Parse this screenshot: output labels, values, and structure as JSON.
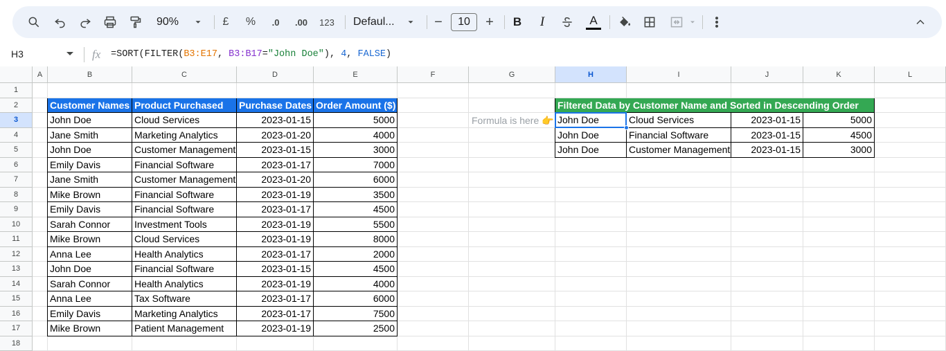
{
  "toolbar": {
    "zoom": "90%",
    "currency": "£",
    "percent": "%",
    "dec_less": ".0",
    "dec_more": ".00",
    "more_formats": "123",
    "font": "Defaul...",
    "font_size": "10",
    "minus": "−",
    "plus": "+",
    "bold": "B",
    "italic": "I",
    "text_color_letter": "A"
  },
  "formula_bar": {
    "name_box": "H3",
    "fx": "fx",
    "formula_parts": [
      "=SORT(FILTER(",
      "B3:E17",
      ", ",
      "B3:B17",
      "=",
      "\"John Doe\"",
      "), ",
      "4",
      ", ",
      "FALSE",
      ")"
    ]
  },
  "columns": [
    "A",
    "B",
    "C",
    "D",
    "E",
    "F",
    "G",
    "H",
    "I",
    "J",
    "K",
    "L"
  ],
  "rows": [
    "1",
    "2",
    "3",
    "4",
    "5",
    "6",
    "7",
    "8",
    "9",
    "10",
    "11",
    "12",
    "13",
    "14",
    "15",
    "16",
    "17",
    "18"
  ],
  "selected_cell": {
    "column": "H",
    "row": "3"
  },
  "source_table": {
    "headers": [
      "Customer Names",
      "Product Purchased",
      "Purchase Dates",
      "Order Amount ($)"
    ],
    "rows": [
      [
        "John Doe",
        "Cloud Services",
        "2023-01-15",
        "5000"
      ],
      [
        "Jane Smith",
        "Marketing Analytics",
        "2023-01-20",
        "4000"
      ],
      [
        "John Doe",
        "Customer Management",
        "2023-01-15",
        "3000"
      ],
      [
        "Emily Davis",
        "Financial Software",
        "2023-01-17",
        "7000"
      ],
      [
        "Jane Smith",
        "Customer Management",
        "2023-01-20",
        "6000"
      ],
      [
        "Mike Brown",
        "Financial Software",
        "2023-01-19",
        "3500"
      ],
      [
        "Emily Davis",
        "Financial Software",
        "2023-01-17",
        "4500"
      ],
      [
        "Sarah Connor",
        "Investment Tools",
        "2023-01-19",
        "5500"
      ],
      [
        "Mike Brown",
        "Cloud Services",
        "2023-01-19",
        "8000"
      ],
      [
        "Anna Lee",
        "Health Analytics",
        "2023-01-17",
        "2000"
      ],
      [
        "John Doe",
        "Financial Software",
        "2023-01-15",
        "4500"
      ],
      [
        "Sarah Connor",
        "Health Analytics",
        "2023-01-19",
        "4000"
      ],
      [
        "Anna Lee",
        "Tax Software",
        "2023-01-17",
        "6000"
      ],
      [
        "Emily Davis",
        "Marketing Analytics",
        "2023-01-17",
        "7500"
      ],
      [
        "Mike Brown",
        "Patient Management",
        "2023-01-19",
        "2500"
      ]
    ]
  },
  "note": "Formula is here 👉",
  "result_table": {
    "header": "Filtered Data by Customer Name and Sorted in Descending Order",
    "rows": [
      [
        "John Doe",
        "Cloud Services",
        "2023-01-15",
        "5000"
      ],
      [
        "John Doe",
        "Financial Software",
        "2023-01-15",
        "4500"
      ],
      [
        "John Doe",
        "Customer Management",
        "2023-01-15",
        "3000"
      ]
    ]
  },
  "colors": {
    "source_header": "#1a73e8",
    "result_header": "#34a853",
    "selection": "#1a73e8",
    "toolbar_bg": "#edf2fa"
  }
}
